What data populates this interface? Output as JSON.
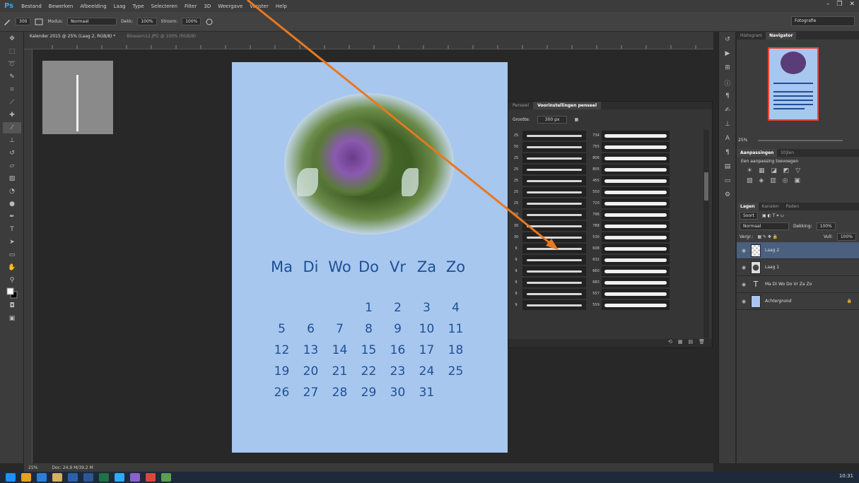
{
  "app": {
    "logo": "Ps",
    "menu": [
      "Bestand",
      "Bewerken",
      "Afbeelding",
      "Laag",
      "Type",
      "Selecteren",
      "Filter",
      "3D",
      "Weergave",
      "Venster",
      "Help"
    ],
    "window_controls": [
      "–",
      "❐",
      "✕"
    ]
  },
  "options_bar": {
    "brush_size": "300",
    "mode_label": "Modus:",
    "mode_value": "Normaal",
    "opacity_label": "Dekk:",
    "opacity_value": "100%",
    "flow_label": "Stroom:",
    "flow_value": "100%",
    "workspace": "Fotografie"
  },
  "tabs": [
    {
      "label": "Kalender 2015 @ 25% (Laag 2, RGB/8) *",
      "active": true
    },
    {
      "label": "Bloesem12.JPG @ 100% (RGB/8)",
      "active": false
    }
  ],
  "calendar": {
    "days": [
      "Ma",
      "Di",
      "Wo",
      "Do",
      "Vr",
      "Za",
      "Zo"
    ],
    "weeks": [
      [
        "",
        "",
        "",
        "1",
        "2",
        "3",
        "4"
      ],
      [
        "5",
        "6",
        "7",
        "8",
        "9",
        "10",
        "11"
      ],
      [
        "12",
        "13",
        "14",
        "15",
        "16",
        "17",
        "18"
      ],
      [
        "19",
        "20",
        "21",
        "22",
        "23",
        "24",
        "25"
      ],
      [
        "26",
        "27",
        "28",
        "29",
        "30",
        "31",
        ""
      ]
    ]
  },
  "status": {
    "zoom": "25%",
    "doc": "Doc: 24,9 M/39,2 M"
  },
  "brush_panel": {
    "tabs": [
      "Penseel",
      "Voorinstellingen penseel"
    ],
    "size_label": "Grootte:",
    "size_value": "300 px",
    "left_numbers": [
      "25",
      "50",
      "25",
      "25",
      "25",
      "25",
      "25",
      "50",
      "30",
      "30",
      "9",
      "9",
      "9",
      "9",
      "9",
      "9"
    ],
    "right_numbers": [
      "734",
      "755",
      "806",
      "805",
      "455",
      "550",
      "720",
      "796",
      "788",
      "530",
      "608",
      "632",
      "660",
      "683",
      "557",
      "559"
    ]
  },
  "right_panels": {
    "nav_tabs": [
      "Histogram",
      "Navigator"
    ],
    "nav_zoom": "25%",
    "adjust_tabs": [
      "Aanpassingen",
      "Stijlen"
    ],
    "adjust_title": "Een aanpassing toevoegen",
    "adjust_icons": [
      "☀",
      "▦",
      "◪",
      "◩",
      "▽",
      "▧",
      "◈",
      "▥",
      "◎",
      "▣"
    ],
    "layers_tabs": [
      "Lagen",
      "Kanalen",
      "Paden"
    ],
    "kind_label": "Soort",
    "blend": "Normaal",
    "opacity_label": "Dekking:",
    "opacity_value": "100%",
    "lock_label": "Vergr.:",
    "fill_label": "Vull:",
    "fill_value": "100%",
    "layers": [
      {
        "name": "Laag 2",
        "selected": true
      },
      {
        "name": "Laag 1",
        "selected": false
      },
      {
        "name": "Ma Di Wo Do Vr Za Zo",
        "selected": false,
        "type": "text"
      },
      {
        "name": "Achtergrond",
        "selected": false,
        "locked": true
      }
    ]
  },
  "taskbar": {
    "time": "10:31"
  },
  "colors": {
    "canvas_bg": "#a7c7ee",
    "calendar_text": "#1f4f96",
    "arrow": "#e8781f",
    "selected_layer": "#4b5f7f"
  }
}
